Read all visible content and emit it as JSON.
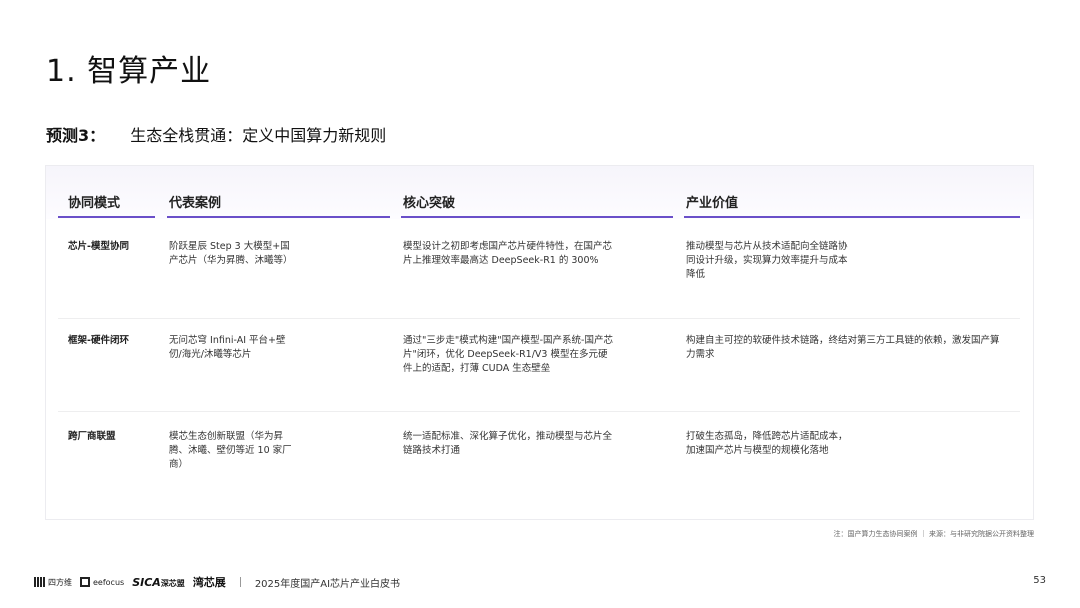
{
  "page": {
    "title": "1. 智算产业",
    "subtitle_label": "预测3：",
    "subtitle_text": "生态全栈贯通：定义中国算力新规则"
  },
  "table": {
    "headers": [
      "协同模式",
      "代表案例",
      "核心突破",
      "产业价值"
    ],
    "rows": [
      {
        "mode": "芯片-模型协同",
        "case": "阶跃星辰 Step 3 大模型+国产芯片（华为昇腾、沐曦等）",
        "breakthrough": "模型设计之初即考虑国产芯片硬件特性，在国产芯片上推理效率最高达 DeepSeek-R1 的 300%",
        "value": "推动模型与芯片从技术适配向全链路协同设计升级，实现算力效率提升与成本降低"
      },
      {
        "mode": "框架-硬件闭环",
        "case": "无问芯穹 Infini-AI 平台+壁仞/海光/沐曦等芯片",
        "breakthrough": "通过\"三步走\"模式构建\"国产模型-国产系统-国产芯片\"闭环，优化 DeepSeek-R1/V3 模型在多元硬件上的适配，打薄 CUDA 生态壁垒",
        "value": "构建自主可控的软硬件技术链路，终结对第三方工具链的依赖，激发国产算力需求"
      },
      {
        "mode": "跨厂商联盟",
        "case": "模芯生态创新联盟（华为昇腾、沐曦、壁仞等近 10 家厂商）",
        "breakthrough": "统一适配标准、深化算子优化，推动模型与芯片全链路技术打通",
        "value": "打破生态孤岛，降低跨芯片适配成本，加速国产芯片与模型的规模化落地"
      }
    ]
  },
  "note": "注：国产算力生态协同案例 ｜ 来源：与非研究院据公开资料整理",
  "footer": {
    "logo1": "四方维",
    "logo2": "eefocus",
    "logo3_main": "SICA",
    "logo3_sub": "深芯盟",
    "logo4": "湾芯展",
    "title": "2025年度国产AI芯片产业白皮书",
    "page_number": "53"
  },
  "colors": {
    "accent": "#6a4fc9",
    "text": "#1a1a1a",
    "header_bg": "#f6f5fb"
  }
}
